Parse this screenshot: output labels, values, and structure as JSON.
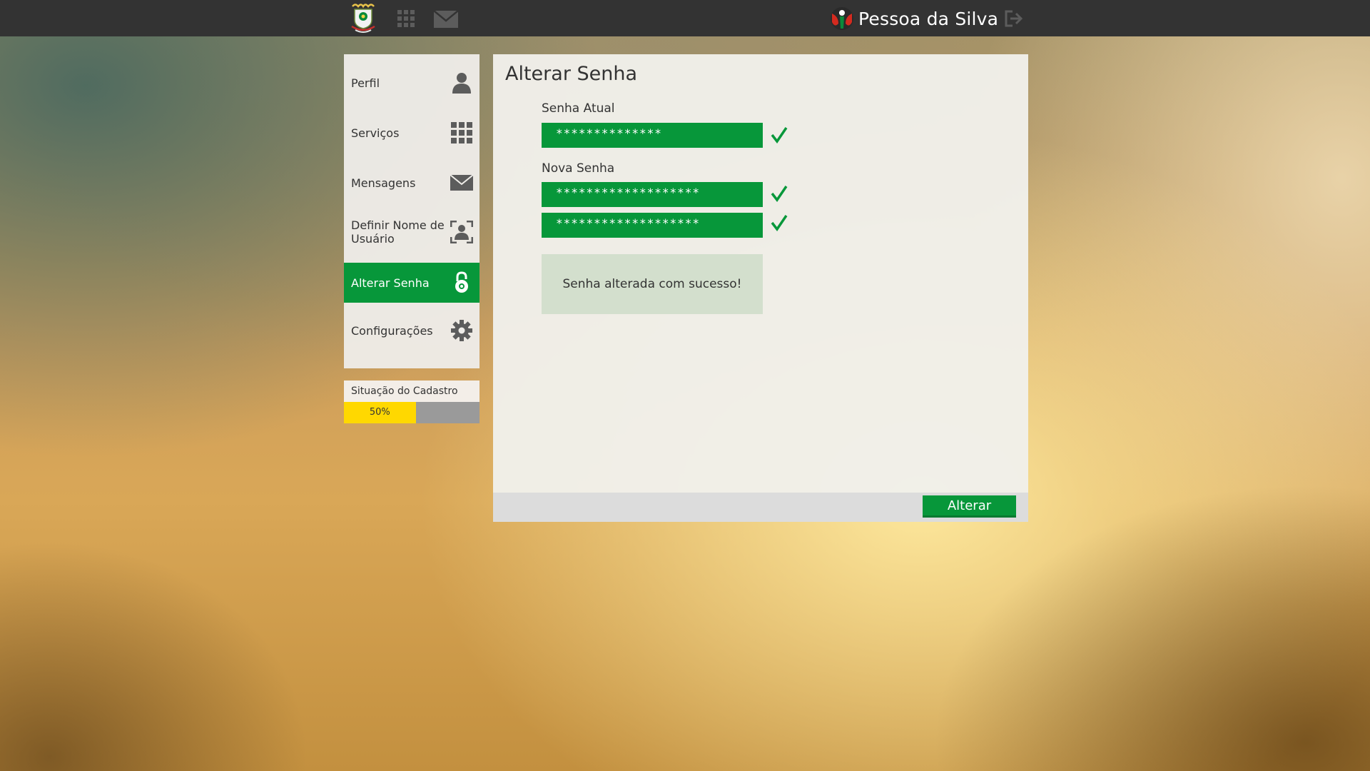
{
  "header": {
    "user_name": "Pessoa da Silva",
    "icons": [
      "crest-logo",
      "apps-grid-icon",
      "mail-icon",
      "user-avatar-icon",
      "logout-icon"
    ]
  },
  "sidebar": {
    "items": [
      {
        "label": "Perfil",
        "icon": "user-icon"
      },
      {
        "label": "Serviços",
        "icon": "grid-icon"
      },
      {
        "label": "Mensagens",
        "icon": "envelope-icon"
      },
      {
        "label": "Definir Nome de Usuário",
        "icon": "user-frame-icon"
      },
      {
        "label": "Alterar Senha",
        "icon": "lock-icon",
        "active": true
      },
      {
        "label": "Configurações",
        "icon": "gear-icon"
      }
    ],
    "status": {
      "title": "Situação do Cadastro",
      "percent_label": "50%",
      "progress": 0.5
    }
  },
  "main": {
    "title": "Alterar Senha",
    "current_password": {
      "label": "Senha Atual",
      "value": "**************",
      "valid": true
    },
    "new_password": {
      "label": "Nova Senha",
      "value": "*******************",
      "confirm_value": "*******************",
      "valid": true
    },
    "success_message": "Senha alterada com sucesso!",
    "submit_label": "Alterar"
  },
  "colors": {
    "accent_green": "#07973a",
    "topbar": "#333333",
    "progress_yellow": "#ffd800",
    "success_bg": "#d3dfcd"
  }
}
